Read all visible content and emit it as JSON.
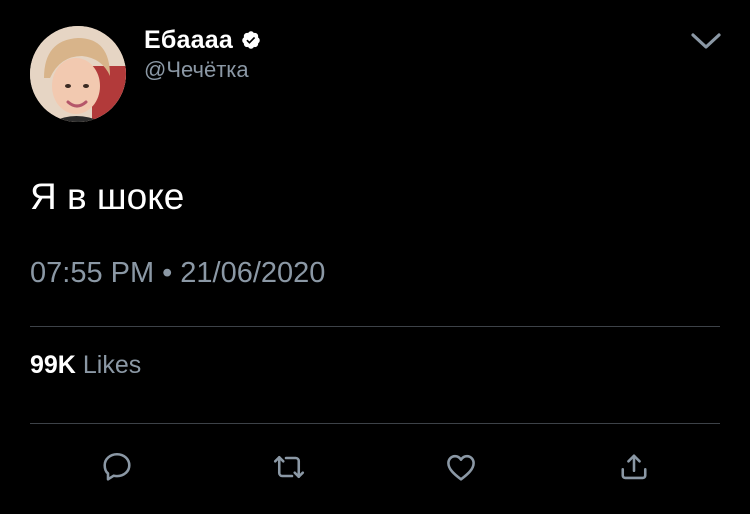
{
  "tweet": {
    "author": {
      "display_name": "Ебаааа",
      "handle": "@Чечётка",
      "verified": true,
      "avatar_icon": "avatar-photo"
    },
    "text": "Я в шоке",
    "time": "07:55 PM",
    "separator": "•",
    "date": "21/06/2020",
    "stats": {
      "likes_count": "99K",
      "likes_label": "Likes"
    },
    "actions": [
      {
        "name": "reply",
        "icon": "comment-icon"
      },
      {
        "name": "retweet",
        "icon": "retweet-icon"
      },
      {
        "name": "like",
        "icon": "heart-icon"
      },
      {
        "name": "share",
        "icon": "share-icon"
      }
    ]
  },
  "colors": {
    "background": "#000000",
    "primary_text": "#ffffff",
    "secondary_text": "#8b98a5",
    "divider": "#3d4248",
    "icon": "#8b98a5"
  }
}
